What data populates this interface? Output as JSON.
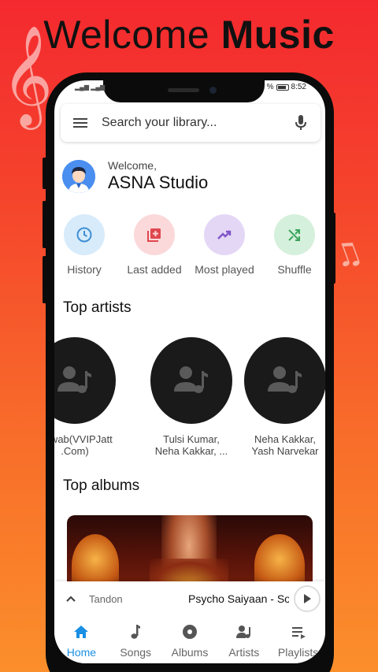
{
  "banner": {
    "headline_light": "Welcome",
    "headline_bold": "Music"
  },
  "status_bar": {
    "time": "8:52",
    "battery_suffix": "%"
  },
  "search": {
    "placeholder": "Search your library..."
  },
  "welcome": {
    "greeting": "Welcome,",
    "name": "ASNA Studio"
  },
  "quick_actions": [
    {
      "label": "History",
      "icon": "history-icon",
      "bg": "#d7ebfb",
      "fg": "#3d8fd6"
    },
    {
      "label": "Last added",
      "icon": "playlist-add-icon",
      "bg": "#fbd8da",
      "fg": "#e0474f"
    },
    {
      "label": "Most played",
      "icon": "trending-up-icon",
      "bg": "#e4d7f6",
      "fg": "#8255c9"
    },
    {
      "label": "Shuffle",
      "icon": "shuffle-icon",
      "bg": "#d5f0dc",
      "fg": "#3ba55c"
    }
  ],
  "sections": {
    "top_artists": "Top artists",
    "top_albums": "Top albums"
  },
  "artists": [
    {
      "name": "Nawab(VVIPJatt\n.Com)"
    },
    {
      "name": "Tulsi Kumar,\nNeha Kakkar, ..."
    },
    {
      "name": "Neha Kakkar,\nYash Narvekar"
    }
  ],
  "mini_player": {
    "artist": "Tandon",
    "title": "Psycho Saiyaan - So"
  },
  "nav": [
    {
      "label": "Home",
      "icon": "home-icon",
      "active": true
    },
    {
      "label": "Songs",
      "icon": "music-note-icon",
      "active": false
    },
    {
      "label": "Albums",
      "icon": "album-icon",
      "active": false
    },
    {
      "label": "Artists",
      "icon": "artist-icon",
      "active": false
    },
    {
      "label": "Playlists",
      "icon": "playlist-icon",
      "active": false
    }
  ],
  "colors": {
    "accent": "#1a8fe3",
    "background_top": "#f4292f",
    "background_bottom": "#fb8f2b"
  }
}
